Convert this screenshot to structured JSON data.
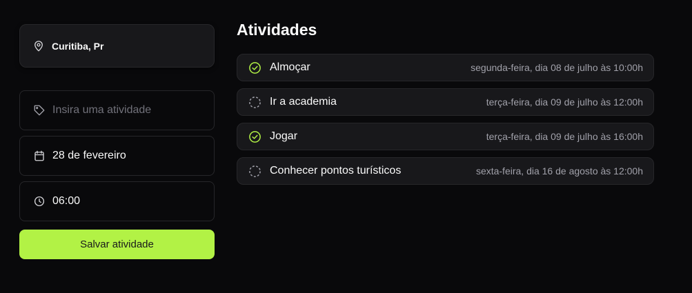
{
  "location": {
    "icon": "map-pin-icon",
    "label": "Curitiba, Pr"
  },
  "form": {
    "activity_placeholder": "Insira uma atividade",
    "activity_icon": "tag-icon",
    "date_value": "28 de fevereiro",
    "date_icon": "calendar-icon",
    "time_value": "06:00",
    "time_icon": "clock-icon",
    "save_label": "Salvar atividade"
  },
  "activities_title": "Atividades",
  "activities": [
    {
      "name": "Almoçar",
      "date": "segunda-feira, dia 08 de julho às 10:00h",
      "done": true
    },
    {
      "name": "Ir a academia",
      "date": "terça-feira, dia 09 de julho às 12:00h",
      "done": false
    },
    {
      "name": "Jogar",
      "date": "terça-feira, dia 09 de julho às 16:00h",
      "done": true
    },
    {
      "name": "Conhecer pontos turísticos",
      "date": "sexta-feira, dia 16 de agosto às 12:00h",
      "done": false
    }
  ],
  "colors": {
    "accent": "#b2f245",
    "background": "#09090b",
    "card": "#18181b",
    "border": "#27272a",
    "muted_text": "#a1a1aa"
  }
}
